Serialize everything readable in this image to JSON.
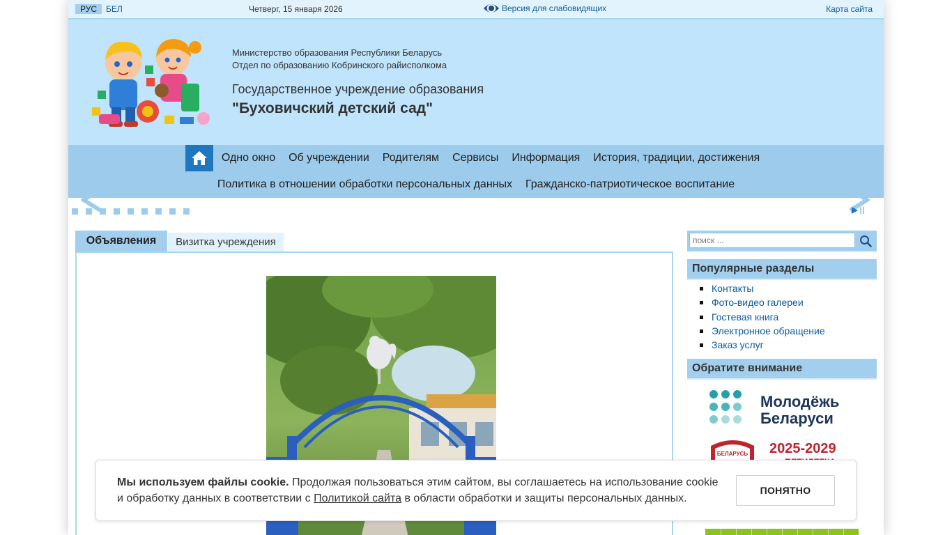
{
  "topbar": {
    "lang_active": "РУС",
    "lang_other": "БЕЛ",
    "date": "Четверг, 15 января 2026",
    "low_vision": "Версия для слабовидящих",
    "sitemap": "Карта сайта"
  },
  "header": {
    "ministry_line1": "Министерство образования Республики Беларусь",
    "ministry_line2": "Отдел по образованию Кобринского райисполкома",
    "org_type": "Государственное учреждение образования",
    "org_name": "\"Буховичский детский сад\""
  },
  "nav": {
    "row1": [
      "Одно окно",
      "Об учреждении",
      "Родителям",
      "Сервисы",
      "Информация",
      "История, традиции, достижения"
    ],
    "row2": [
      "Политика в отношении обработки персональных данных",
      "Гражданско-патриотическое воспитание"
    ]
  },
  "slider": {
    "dot_count": 9
  },
  "tabs": {
    "active": "Объявления",
    "inactive": "Визитка учреждения"
  },
  "search": {
    "placeholder": "поиск ..."
  },
  "sidebar": {
    "popular_title": "Популярные разделы",
    "popular_items": [
      "Контакты",
      "Фото-видео галереи",
      "Гостевая книга",
      "Электронное обращение",
      "Заказ услуг"
    ],
    "attention_title": "Обратите внимание",
    "banner1_line1": "Молодёжь",
    "banner1_line2": "Беларуси",
    "banner2_years": "2025-2029",
    "banner2_sub": "ПЯТИЛЕТКА",
    "banner2_badge": "БЕЛАРУСЬ"
  },
  "cookie": {
    "bold": "Мы используем файлы cookie.",
    "text1": " Продолжая пользоваться этим сайтом, вы соглашаетесь на использование cookie и обработку данных в соответствии с ",
    "link": "Политикой сайта",
    "text2": " в области обработки и защиты персональных данных.",
    "button": "ПОНЯТНО"
  },
  "colors": {
    "topbar_bg": "#e3f3fd",
    "header_bg": "#bfe4fb",
    "nav_bg": "#9dcbeb",
    "accent": "#1f77bf",
    "link": "#0d5a9a"
  }
}
